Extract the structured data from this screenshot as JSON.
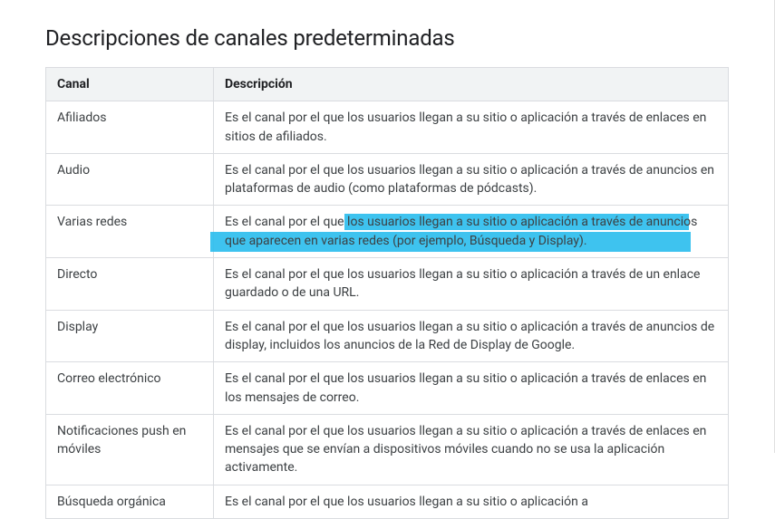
{
  "title": "Descripciones de canales predeterminadas",
  "headers": {
    "channel": "Canal",
    "description": "Descripción"
  },
  "rows": [
    {
      "channel": "Afiliados",
      "description": "Es el canal por el que los usuarios llegan a su sitio o aplicación a través de enlaces en sitios de afiliados."
    },
    {
      "channel": "Audio",
      "description": "Es el canal por el que los usuarios llegan a su sitio o aplicación a través de anuncios en plataformas de audio (como plataformas de pódcasts)."
    },
    {
      "channel": "Varias redes",
      "description": "Es el canal por el que los usuarios llegan a su sitio o aplicación a través de anuncios que aparecen en varias redes (por ejemplo, Búsqueda y Display)."
    },
    {
      "channel": "Directo",
      "description": "Es el canal por el que los usuarios llegan a su sitio o aplicación a través de un enlace guardado o de una URL."
    },
    {
      "channel": "Display",
      "description": "Es el canal por el que los usuarios llegan a su sitio o aplicación a través de anuncios de display, incluidos los anuncios de la Red de Display de Google."
    },
    {
      "channel": "Correo electrónico",
      "description": "Es el canal por el que los usuarios llegan a su sitio o aplicación a través de enlaces en los mensajes de correo."
    },
    {
      "channel": "Notificaciones push en móviles",
      "description": "Es el canal por el que los usuarios llegan a su sitio o aplicación a través de enlaces en mensajes que se envían a dispositivos móviles cuando no se usa la aplicación activamente."
    },
    {
      "channel": "Búsqueda orgánica",
      "description": "Es el canal por el que los usuarios llegan a su sitio o aplicación a"
    }
  ]
}
